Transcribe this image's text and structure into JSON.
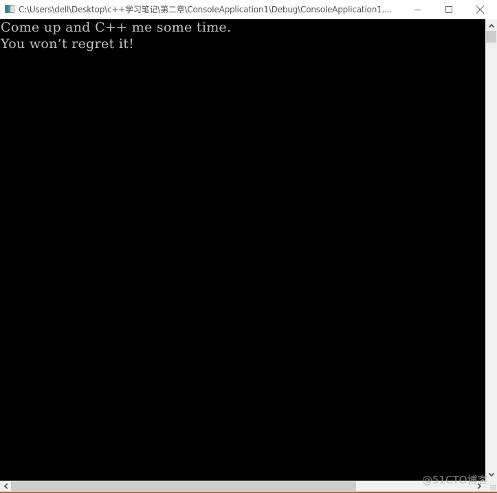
{
  "window": {
    "title": "C:\\Users\\dell\\Desktop\\c++学习笔记\\第二章\\ConsoleApplication1\\Debug\\ConsoleApplication1....",
    "icon": "console-app-icon",
    "controls": {
      "minimize": "minimize-icon",
      "maximize": "maximize-icon",
      "close": "close-icon"
    }
  },
  "console": {
    "background": "#000000",
    "text_color": "#c0c0c0",
    "lines": [
      "Come up and C++ me some time.",
      "You won’t regret it!"
    ]
  },
  "scrollbars": {
    "vertical": {
      "position_fraction": 0.0
    },
    "horizontal": {
      "position_fraction": 0.0,
      "visible_fraction": 0.73
    }
  },
  "watermark": "@51CTO博客"
}
